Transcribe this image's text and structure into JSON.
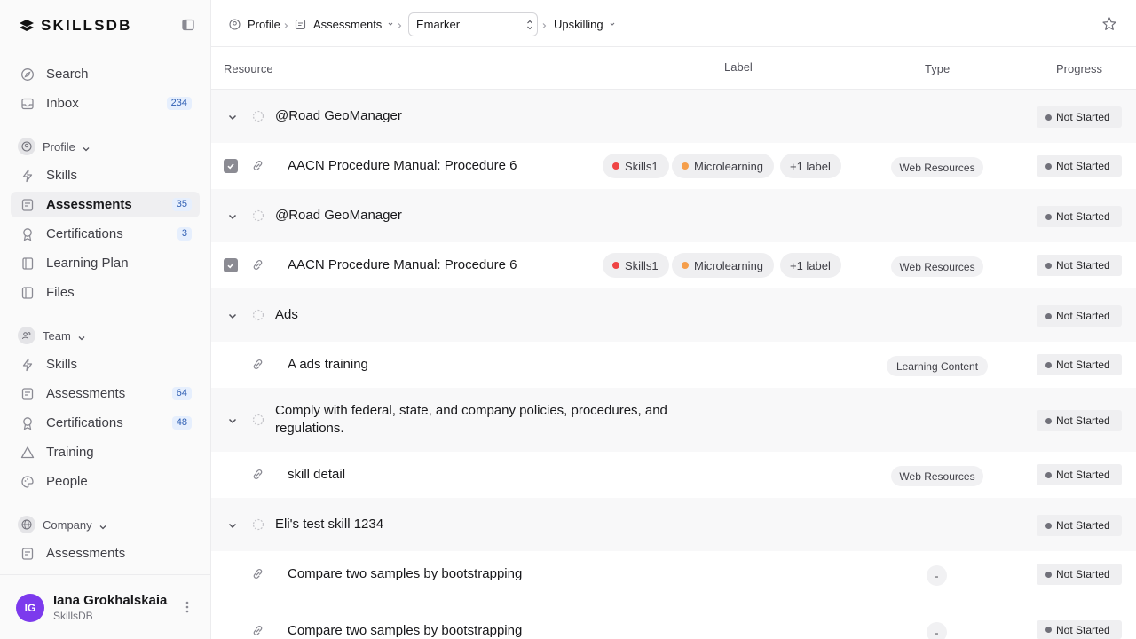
{
  "app": {
    "name": "SKILLSDB"
  },
  "sidebar": {
    "top_items": [
      {
        "label": "Search",
        "icon": "compass-icon"
      },
      {
        "label": "Inbox",
        "icon": "inbox-icon",
        "badge": "234"
      }
    ],
    "profile_section": {
      "label": "Profile",
      "items": [
        {
          "label": "Skills",
          "icon": "bolt-icon"
        },
        {
          "label": "Assessments",
          "icon": "assessment-icon",
          "badge": "35",
          "active": true
        },
        {
          "label": "Certifications",
          "icon": "award-icon",
          "badge": "3"
        },
        {
          "label": "Learning Plan",
          "icon": "book-icon"
        },
        {
          "label": "Files",
          "icon": "file-icon"
        }
      ]
    },
    "team_section": {
      "label": "Team",
      "items": [
        {
          "label": "Skills",
          "icon": "bolt-icon"
        },
        {
          "label": "Assessments",
          "icon": "assessment-icon",
          "badge": "64"
        },
        {
          "label": "Certifications",
          "icon": "award-icon",
          "badge": "48"
        },
        {
          "label": "Training",
          "icon": "triangle-icon"
        },
        {
          "label": "People",
          "icon": "palette-icon"
        }
      ]
    },
    "company_section": {
      "label": "Company",
      "items": [
        {
          "label": "Assessments",
          "icon": "assessment-icon"
        }
      ]
    },
    "user": {
      "initials": "IG",
      "name": "Iana Grokhalskaia",
      "org": "SkillsDB"
    }
  },
  "breadcrumb": {
    "profile": "Profile",
    "assessments": "Assessments",
    "selected": "Emarker",
    "upskilling": "Upskilling"
  },
  "table": {
    "columns": {
      "resource": "Resource",
      "label": "Label",
      "type": "Type",
      "progress": "Progress"
    },
    "rows": [
      {
        "kind": "group",
        "title": "@Road GeoManager",
        "status": "Not Started"
      },
      {
        "kind": "item",
        "title": "AACN Procedure Manual: Procedure 6",
        "checked": true,
        "chips": [
          {
            "label": "Skills1",
            "color": "#ef4444"
          },
          {
            "label": "Microlearning",
            "color": "#f59e4b"
          },
          {
            "label": "+1 label"
          }
        ],
        "type": "Web Resources",
        "status": "Not Started"
      },
      {
        "kind": "group",
        "title": "@Road GeoManager",
        "status": "Not Started"
      },
      {
        "kind": "item",
        "title": "AACN Procedure Manual: Procedure 6",
        "checked": true,
        "chips": [
          {
            "label": "Skills1",
            "color": "#ef4444"
          },
          {
            "label": "Microlearning",
            "color": "#f59e4b"
          },
          {
            "label": "+1 label"
          }
        ],
        "type": "Web Resources",
        "status": "Not Started"
      },
      {
        "kind": "group",
        "title": "Ads",
        "status": "Not Started"
      },
      {
        "kind": "item",
        "title": "A ads training",
        "type": "Learning Content",
        "status": "Not Started"
      },
      {
        "kind": "group",
        "title_line1": "Comply with federal, state, and company policies, procedures, and",
        "title_line2": "regulations.",
        "status": "Not Started"
      },
      {
        "kind": "item",
        "title": "skill detail",
        "type": "Web Resources",
        "status": "Not Started"
      },
      {
        "kind": "group",
        "title": "Eli's test skill 1234",
        "status": "Not Started"
      },
      {
        "kind": "item",
        "title": "Compare two samples by bootstrapping",
        "type": "-",
        "status": "Not Started"
      },
      {
        "kind": "item",
        "title": "Compare two samples by bootstrapping",
        "type": "-",
        "status": "Not Started"
      }
    ]
  }
}
